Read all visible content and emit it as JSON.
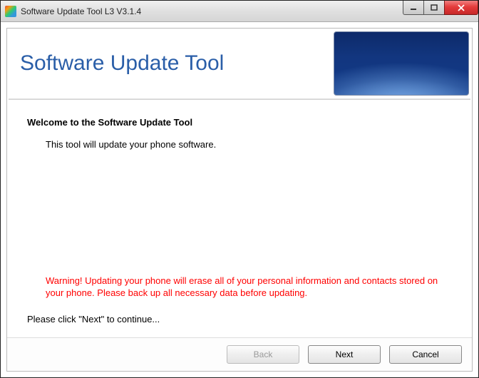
{
  "window": {
    "title": "Software Update Tool L3 V3.1.4"
  },
  "header": {
    "title": "Software Update Tool"
  },
  "body": {
    "welcome": "Welcome to the Software Update Tool",
    "description": "This tool will update your phone software.",
    "warning": "Warning! Updating your phone will erase all of your personal information and contacts stored on your phone. Please back up all necessary data before updating.",
    "instruction": "Please click \"Next\" to continue..."
  },
  "buttons": {
    "back": "Back",
    "next": "Next",
    "cancel": "Cancel"
  }
}
